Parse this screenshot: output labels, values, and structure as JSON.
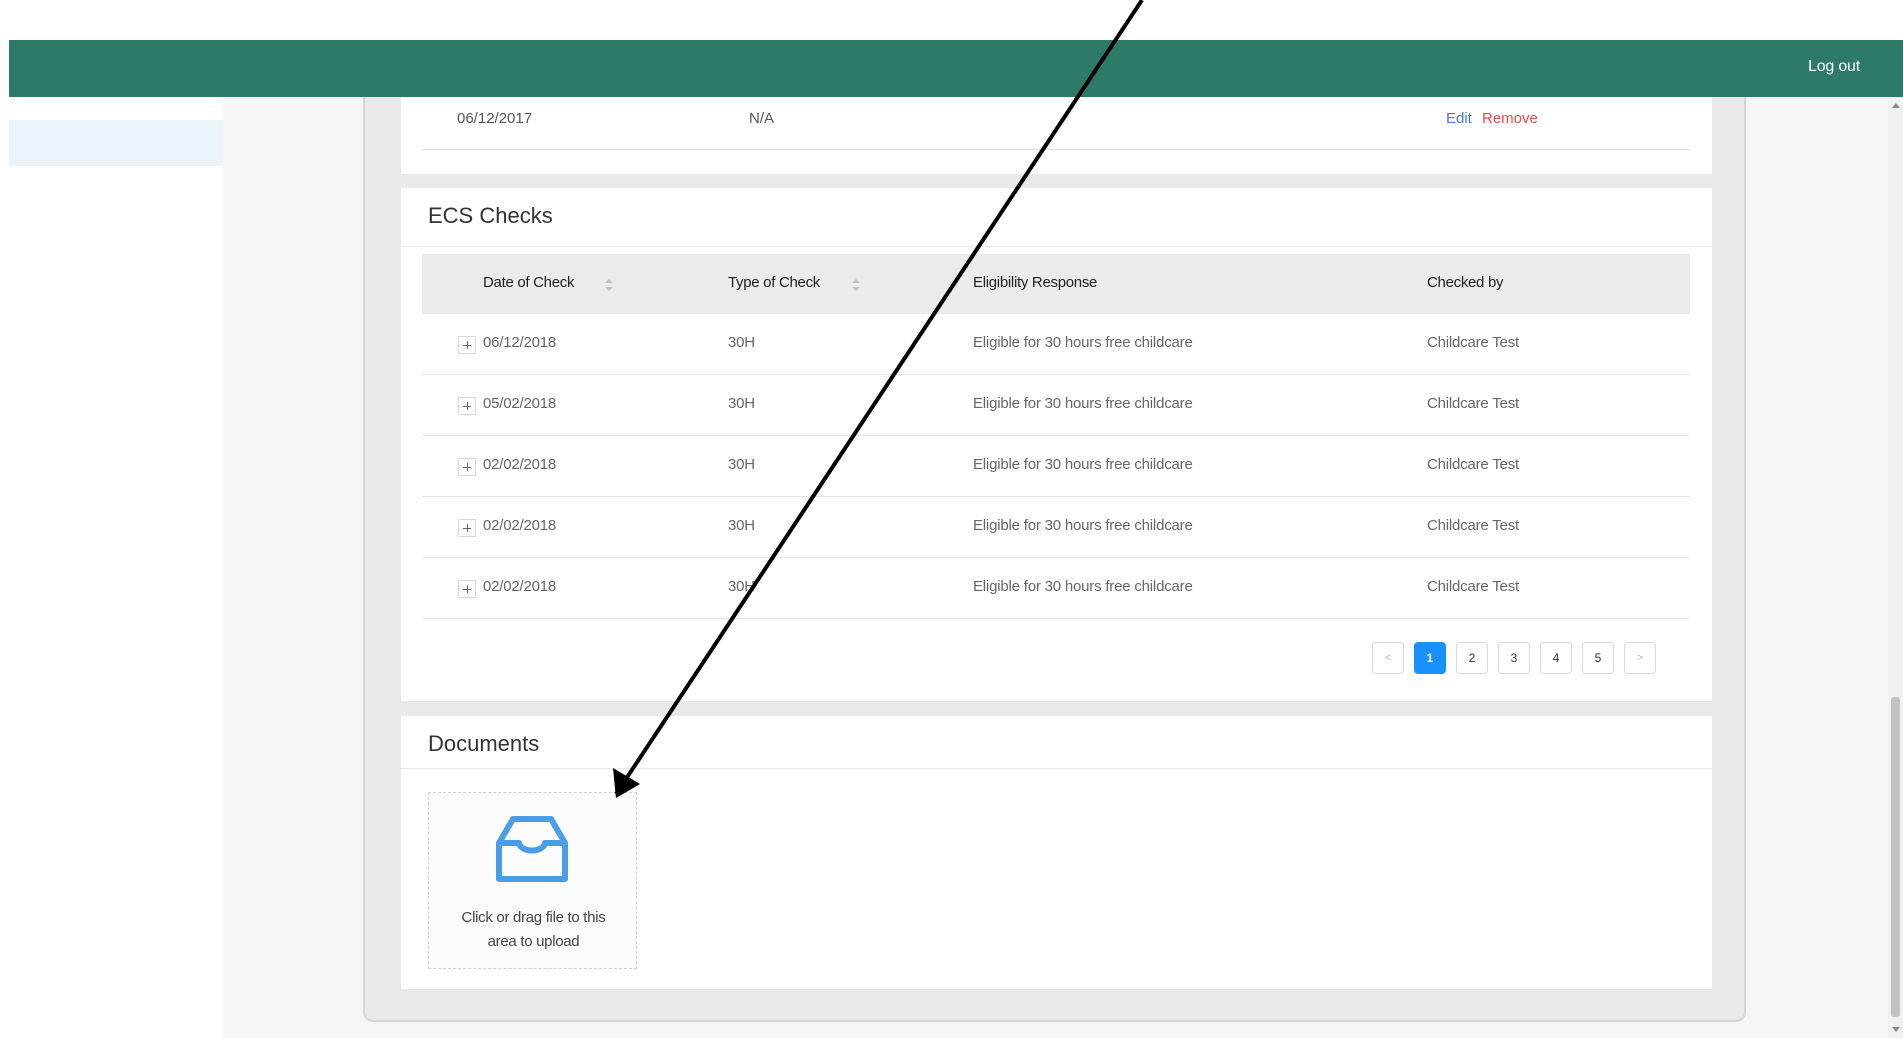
{
  "header": {
    "logout_label": "Log out",
    "bg_color": "#2e7a69"
  },
  "previous_section": {
    "row": {
      "date": "06/12/2017",
      "value": "N/A",
      "edit_label": "Edit",
      "remove_label": "Remove"
    }
  },
  "ecs_checks": {
    "title": "ECS Checks",
    "columns": [
      {
        "label": "Date of Check",
        "sortable": true
      },
      {
        "label": "Type of Check",
        "sortable": true
      },
      {
        "label": "Eligibility Response",
        "sortable": false
      },
      {
        "label": "Checked by",
        "sortable": false
      }
    ],
    "rows": [
      {
        "date": "06/12/2018",
        "type": "30H",
        "response": "Eligible for 30 hours free childcare",
        "checked_by": "Childcare Test"
      },
      {
        "date": "05/02/2018",
        "type": "30H",
        "response": "Eligible for 30 hours free childcare",
        "checked_by": "Childcare Test"
      },
      {
        "date": "02/02/2018",
        "type": "30H",
        "response": "Eligible for 30 hours free childcare",
        "checked_by": "Childcare Test"
      },
      {
        "date": "02/02/2018",
        "type": "30H",
        "response": "Eligible for 30 hours free childcare",
        "checked_by": "Childcare Test"
      },
      {
        "date": "02/02/2018",
        "type": "30H",
        "response": "Eligible for 30 hours free childcare",
        "checked_by": "Childcare Test"
      }
    ],
    "pagination": {
      "prev_label": "<",
      "pages": [
        "1",
        "2",
        "3",
        "4",
        "5"
      ],
      "current_page": "1",
      "next_label": ">"
    }
  },
  "documents": {
    "title": "Documents",
    "upload_text_line1": "Click or drag file to this",
    "upload_text_line2": "area to upload",
    "upload_icon": "inbox-icon",
    "accent_color": "#4a9ee8"
  }
}
